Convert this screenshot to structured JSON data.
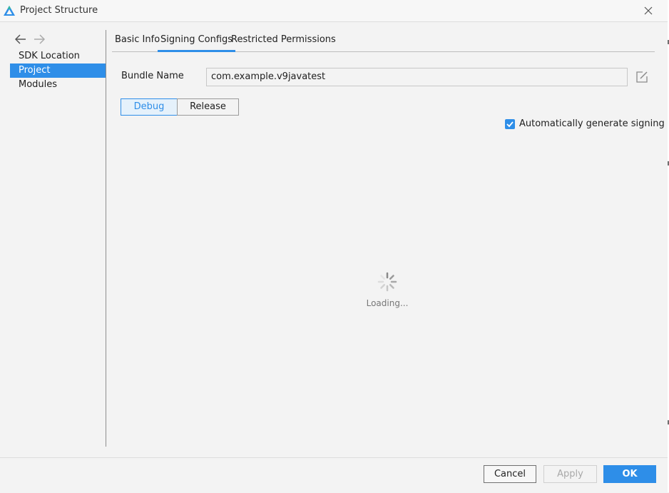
{
  "window": {
    "title": "Project Structure",
    "logo_icon": "app-logo-icon",
    "close_icon": "close-icon"
  },
  "sidebar": {
    "back_icon": "arrow-left-icon",
    "forward_icon": "arrow-right-icon",
    "items": [
      {
        "label": "SDK Location",
        "selected": false
      },
      {
        "label": "Project",
        "selected": true
      },
      {
        "label": "Modules",
        "selected": false
      }
    ]
  },
  "tabs": [
    {
      "label": "Basic Info",
      "active": false
    },
    {
      "label": "Signing Configs",
      "active": true
    },
    {
      "label": "Restricted Permissions",
      "active": false
    }
  ],
  "bundle": {
    "label": "Bundle Name",
    "value": "com.example.v9javatest",
    "edit_icon": "edit-icon"
  },
  "build_type": {
    "options": [
      "Debug",
      "Release"
    ],
    "selected": "Debug"
  },
  "auto_signing": {
    "label": "Automatically generate signing",
    "checked": true
  },
  "loading": {
    "text": "Loading...",
    "icon": "spinner-icon"
  },
  "footer": {
    "cancel": "Cancel",
    "apply": "Apply",
    "ok": "OK"
  },
  "colors": {
    "accent": "#2e8ee8",
    "background": "#f3f3f3",
    "disabled_text": "#a8a8a8"
  }
}
